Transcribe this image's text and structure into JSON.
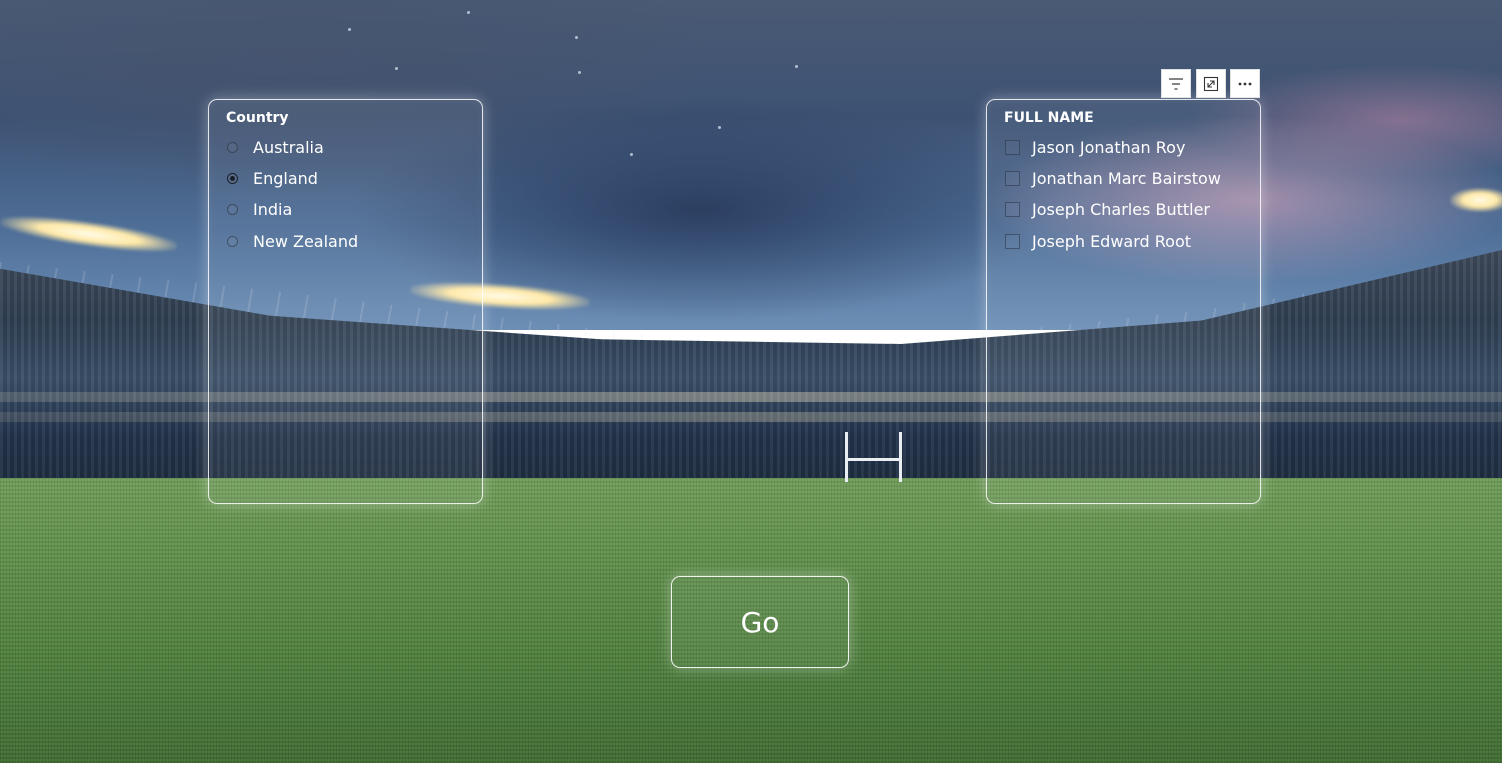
{
  "country_slicer": {
    "title": "Country",
    "options": [
      {
        "label": "Australia",
        "selected": false
      },
      {
        "label": "England",
        "selected": true
      },
      {
        "label": "India",
        "selected": false
      },
      {
        "label": "New Zealand",
        "selected": false
      }
    ]
  },
  "name_slicer": {
    "title": "FULL NAME",
    "options": [
      {
        "label": "Jason Jonathan Roy",
        "checked": false
      },
      {
        "label": "Jonathan Marc Bairstow",
        "checked": false
      },
      {
        "label": "Joseph Charles Buttler",
        "checked": false
      },
      {
        "label": "Joseph Edward Root",
        "checked": false
      }
    ]
  },
  "visual_header": {
    "icons": [
      "filter-icon",
      "focus-mode-icon",
      "more-options-icon"
    ]
  },
  "go_button": {
    "label": "Go"
  }
}
